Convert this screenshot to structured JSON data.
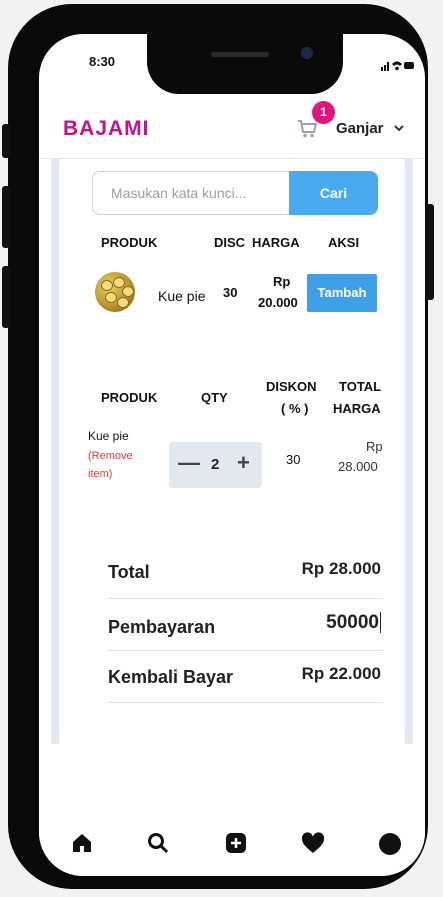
{
  "status_bar": {
    "time": "8:30"
  },
  "header": {
    "brand": "BAJAMI",
    "cart_count": "1",
    "user_name": "Ganjar"
  },
  "search": {
    "placeholder": "Masukan kata kunci...",
    "button_label": "Cari"
  },
  "product_table": {
    "headers": [
      "PRODUK",
      "DISC",
      "HARGA",
      "AKSI"
    ],
    "rows": [
      {
        "name": "Kue pie",
        "disc": "30",
        "price_line1": "Rp",
        "price_line2": "20.000",
        "action": "Tambah"
      }
    ]
  },
  "cart_table": {
    "headers": {
      "produk": "PRODUK",
      "qty": "QTY",
      "diskon_line1": "DISKON",
      "diskon_line2": "( % )",
      "total_line1": "TOTAL",
      "total_line2": "HARGA"
    },
    "rows": [
      {
        "name": "Kue pie",
        "remove_line1": "(Remove",
        "remove_line2": "item)",
        "qty": "2",
        "minus": "—",
        "plus": "+",
        "diskon": "30",
        "total_line1": "Rp",
        "total_line2": "28.000"
      }
    ]
  },
  "summary": {
    "total_label": "Total",
    "total_value": "Rp 28.000",
    "payment_label": "Pembayaran",
    "payment_value": "50000",
    "change_label": "Kembali Bayar",
    "change_value": "Rp 22.000"
  },
  "colors": {
    "brand": "#c2128c",
    "primary": "#4aaaf0",
    "badge": "#e0157c",
    "remove": "#e53935"
  },
  "bottom_nav": [
    "home-icon",
    "search-icon",
    "add-square-icon",
    "heart-icon",
    "profile-icon"
  ]
}
